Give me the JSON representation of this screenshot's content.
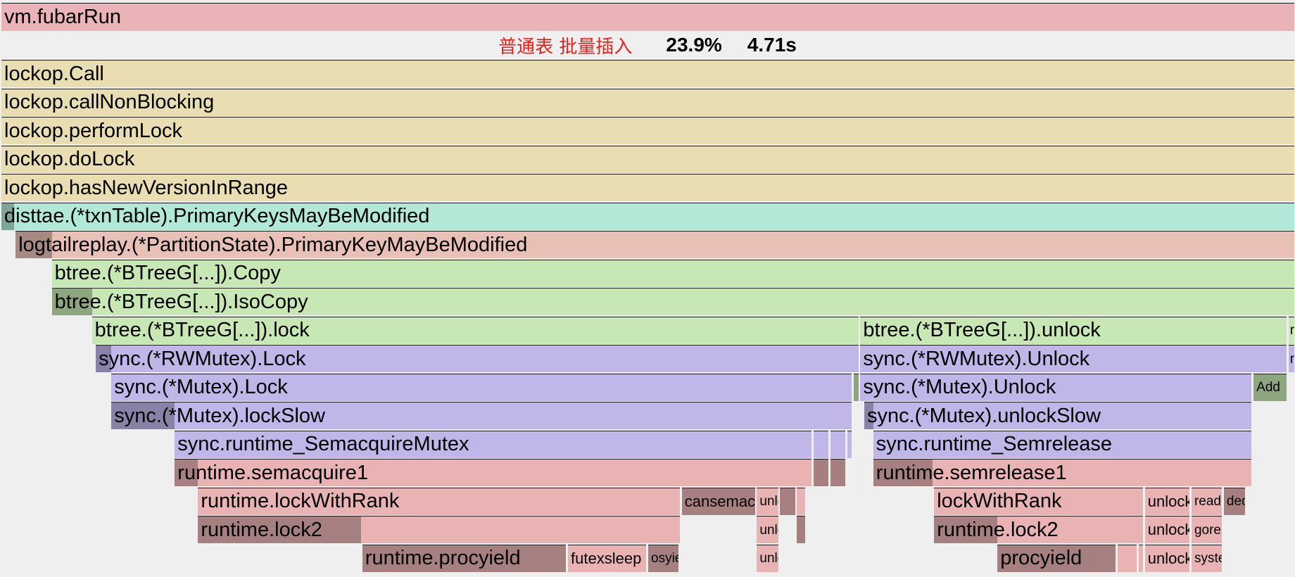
{
  "status": {
    "selected_name": "普通表 批量插入",
    "percent": "23.9%",
    "duration": "4.71s"
  },
  "colors": {
    "root": "#e9b3b8",
    "lockop": "#e9ddb2",
    "disttae": "#b2e8d8",
    "logtail": "#e8c0b5",
    "btree": "#c7e8b5",
    "sync": "#c1b6e8",
    "runtime": "#e9b3b3",
    "dark_root": "#b58a8d",
    "dark_disttae": "#7fa598",
    "dark_logtail": "#a68a82",
    "dark_btree": "#8da67f",
    "dark_sync": "#8a81a6",
    "dark_runtime": "#a68080"
  },
  "chart_data": {
    "type": "flamegraph",
    "frames": [
      {
        "id": "f0",
        "label": "vm.fubarRun",
        "depth": 0,
        "start": 0.0,
        "end": 1.0,
        "kind": "root",
        "self": 0.0
      },
      {
        "id": "f1",
        "label": "lockop.Call",
        "depth": 2,
        "start": 0.0,
        "end": 1.0,
        "kind": "lockop",
        "self": 0.0
      },
      {
        "id": "f2",
        "label": "lockop.callNonBlocking",
        "depth": 3,
        "start": 0.0,
        "end": 1.0,
        "kind": "lockop",
        "self": 0.0
      },
      {
        "id": "f3",
        "label": "lockop.performLock",
        "depth": 4,
        "start": 0.0,
        "end": 1.0,
        "kind": "lockop",
        "self": 0.0
      },
      {
        "id": "f4",
        "label": "lockop.doLock",
        "depth": 5,
        "start": 0.0,
        "end": 1.0,
        "kind": "lockop",
        "self": 0.0
      },
      {
        "id": "f5",
        "label": "lockop.hasNewVersionInRange",
        "depth": 6,
        "start": 0.0,
        "end": 1.0,
        "kind": "lockop",
        "self": 0.0
      },
      {
        "id": "f6",
        "label": "disttae.(*txnTable).PrimaryKeysMayBeModified",
        "depth": 7,
        "start": 0.0,
        "end": 1.0,
        "kind": "disttae",
        "self": 0.01
      },
      {
        "id": "f7",
        "label": "logtailreplay.(*PartitionState).PrimaryKeyMayBeModified",
        "depth": 8,
        "start": 0.011,
        "end": 1.0,
        "kind": "logtail",
        "self": 0.028
      },
      {
        "id": "f8",
        "label": "btree.(*BTreeG[...]).Copy",
        "depth": 9,
        "start": 0.039,
        "end": 1.0,
        "kind": "btree",
        "self": 0.0
      },
      {
        "id": "f9",
        "label": "btree.(*BTreeG[...]).IsoCopy",
        "depth": 10,
        "start": 0.039,
        "end": 1.0,
        "kind": "btree",
        "self": 0.031
      },
      {
        "id": "f10",
        "label": "btree.(*BTreeG[...]).lock",
        "depth": 11,
        "start": 0.07,
        "end": 0.663,
        "kind": "btree",
        "self": 0.0
      },
      {
        "id": "f11",
        "label": "btree.(*BTreeG[...]).unlock",
        "depth": 11,
        "start": 0.664,
        "end": 0.994,
        "kind": "btree",
        "self": 0.0
      },
      {
        "id": "f12",
        "label": "r",
        "depth": 11,
        "start": 0.995,
        "end": 1.0,
        "kind": "btree",
        "self": 0.0
      },
      {
        "id": "f13",
        "label": "sync.(*RWMutex).Lock",
        "depth": 12,
        "start": 0.073,
        "end": 0.663,
        "kind": "sync",
        "self": 0.012
      },
      {
        "id": "f14",
        "label": "sync.(*RWMutex).Unlock",
        "depth": 12,
        "start": 0.664,
        "end": 0.994,
        "kind": "sync",
        "self": 0.0
      },
      {
        "id": "f15",
        "label": "r",
        "depth": 12,
        "start": 0.995,
        "end": 1.0,
        "kind": "sync",
        "self": 0.0
      },
      {
        "id": "f16",
        "label": "sync.(*Mutex).Lock",
        "depth": 13,
        "start": 0.085,
        "end": 0.658,
        "kind": "sync",
        "self": 0.0
      },
      {
        "id": "f17",
        "label": "",
        "depth": 13,
        "start": 0.659,
        "end": 0.663,
        "kind": "btree",
        "self": 0.004
      },
      {
        "id": "f18",
        "label": "sync.(*Mutex).Unlock",
        "depth": 13,
        "start": 0.664,
        "end": 0.967,
        "kind": "sync",
        "self": 0.0
      },
      {
        "id": "f19",
        "label": "Add",
        "depth": 13,
        "start": 0.968,
        "end": 0.994,
        "kind": "btree",
        "self": 0.026
      },
      {
        "id": "f20",
        "label": "sync.(*Mutex).lockSlow",
        "depth": 14,
        "start": 0.085,
        "end": 0.658,
        "kind": "sync",
        "self": 0.049
      },
      {
        "id": "f21",
        "label": "sync.(*Mutex).unlockSlow",
        "depth": 14,
        "start": 0.667,
        "end": 0.967,
        "kind": "sync",
        "self": 0.007
      },
      {
        "id": "f22",
        "label": "sync.runtime_SemacquireMutex",
        "depth": 15,
        "start": 0.134,
        "end": 0.627,
        "kind": "sync",
        "self": 0.0
      },
      {
        "id": "f23",
        "label": "",
        "depth": 15,
        "start": 0.628,
        "end": 0.64,
        "kind": "sync",
        "self": 0.0
      },
      {
        "id": "f24",
        "label": "",
        "depth": 15,
        "start": 0.641,
        "end": 0.653,
        "kind": "sync",
        "self": 0.0
      },
      {
        "id": "f25",
        "label": "",
        "depth": 15,
        "start": 0.654,
        "end": 0.658,
        "kind": "sync",
        "self": 0.0
      },
      {
        "id": "f26",
        "label": "sync.runtime_Semrelease",
        "depth": 15,
        "start": 0.674,
        "end": 0.967,
        "kind": "sync",
        "self": 0.0
      },
      {
        "id": "f27",
        "label": "runtime.semacquire1",
        "depth": 16,
        "start": 0.134,
        "end": 0.627,
        "kind": "runtime",
        "self": 0.018
      },
      {
        "id": "f28",
        "label": "",
        "depth": 16,
        "start": 0.628,
        "end": 0.64,
        "kind": "runtime",
        "self": 0.012
      },
      {
        "id": "f29",
        "label": "",
        "depth": 16,
        "start": 0.641,
        "end": 0.653,
        "kind": "runtime",
        "self": 0.012
      },
      {
        "id": "f30",
        "label": "runtime.semrelease1",
        "depth": 16,
        "start": 0.674,
        "end": 0.967,
        "kind": "runtime",
        "self": 0.046
      },
      {
        "id": "f31",
        "label": "runtime.lockWithRank",
        "depth": 17,
        "start": 0.152,
        "end": 0.525,
        "kind": "runtime",
        "self": 0.0
      },
      {
        "id": "f32",
        "label": "cansemacquire",
        "depth": 17,
        "start": 0.526,
        "end": 0.583,
        "kind": "runtime",
        "self": 0.057
      },
      {
        "id": "f33",
        "label": "unlock",
        "depth": 17,
        "start": 0.584,
        "end": 0.601,
        "kind": "runtime",
        "self": 0.0
      },
      {
        "id": "f34",
        "label": "",
        "depth": 17,
        "start": 0.602,
        "end": 0.614,
        "kind": "runtime",
        "self": 0.012
      },
      {
        "id": "f35",
        "label": "",
        "depth": 17,
        "start": 0.615,
        "end": 0.622,
        "kind": "runtime",
        "self": 0.0
      },
      {
        "id": "f36",
        "label": "lockWithRank",
        "depth": 17,
        "start": 0.721,
        "end": 0.883,
        "kind": "runtime",
        "self": 0.0
      },
      {
        "id": "f37",
        "label": "unlock",
        "depth": 17,
        "start": 0.884,
        "end": 0.919,
        "kind": "runtime",
        "self": 0.0
      },
      {
        "id": "f38",
        "label": "read",
        "depth": 17,
        "start": 0.92,
        "end": 0.944,
        "kind": "runtime",
        "self": 0.0
      },
      {
        "id": "f39",
        "label": "dec",
        "depth": 17,
        "start": 0.945,
        "end": 0.962,
        "kind": "runtime",
        "self": 0.017
      },
      {
        "id": "f40",
        "label": "runtime.lock2",
        "depth": 18,
        "start": 0.152,
        "end": 0.525,
        "kind": "runtime",
        "self": 0.126
      },
      {
        "id": "f41",
        "label": "unlock",
        "depth": 18,
        "start": 0.584,
        "end": 0.601,
        "kind": "runtime",
        "self": 0.0
      },
      {
        "id": "f42",
        "label": "",
        "depth": 18,
        "start": 0.615,
        "end": 0.622,
        "kind": "runtime",
        "self": 0.007
      },
      {
        "id": "f43",
        "label": "runtime.lock2",
        "depth": 18,
        "start": 0.721,
        "end": 0.883,
        "kind": "runtime",
        "self": 0.049
      },
      {
        "id": "f44",
        "label": "unlock",
        "depth": 18,
        "start": 0.884,
        "end": 0.919,
        "kind": "runtime",
        "self": 0.0
      },
      {
        "id": "f45",
        "label": "goready",
        "depth": 18,
        "start": 0.92,
        "end": 0.944,
        "kind": "runtime",
        "self": 0.0
      },
      {
        "id": "f46",
        "label": "runtime.procyield",
        "depth": 19,
        "start": 0.279,
        "end": 0.437,
        "kind": "runtime",
        "self": 0.158
      },
      {
        "id": "f47",
        "label": "futexsleep",
        "depth": 19,
        "start": 0.438,
        "end": 0.499,
        "kind": "runtime",
        "self": 0.0
      },
      {
        "id": "f48",
        "label": "osyield",
        "depth": 19,
        "start": 0.5,
        "end": 0.524,
        "kind": "runtime",
        "self": 0.024
      },
      {
        "id": "f49",
        "label": "unlock",
        "depth": 19,
        "start": 0.584,
        "end": 0.601,
        "kind": "runtime",
        "self": 0.0
      },
      {
        "id": "f50",
        "label": "procyield",
        "depth": 19,
        "start": 0.77,
        "end": 0.862,
        "kind": "runtime",
        "self": 0.092
      },
      {
        "id": "f51",
        "label": "",
        "depth": 19,
        "start": 0.863,
        "end": 0.878,
        "kind": "runtime",
        "self": 0.0
      },
      {
        "id": "f52",
        "label": "",
        "depth": 19,
        "start": 0.879,
        "end": 0.883,
        "kind": "runtime",
        "self": 0.0
      },
      {
        "id": "f53",
        "label": "unlock",
        "depth": 19,
        "start": 0.884,
        "end": 0.919,
        "kind": "runtime",
        "self": 0.0
      },
      {
        "id": "f54",
        "label": "system",
        "depth": 19,
        "start": 0.92,
        "end": 0.944,
        "kind": "runtime",
        "self": 0.0
      }
    ]
  }
}
